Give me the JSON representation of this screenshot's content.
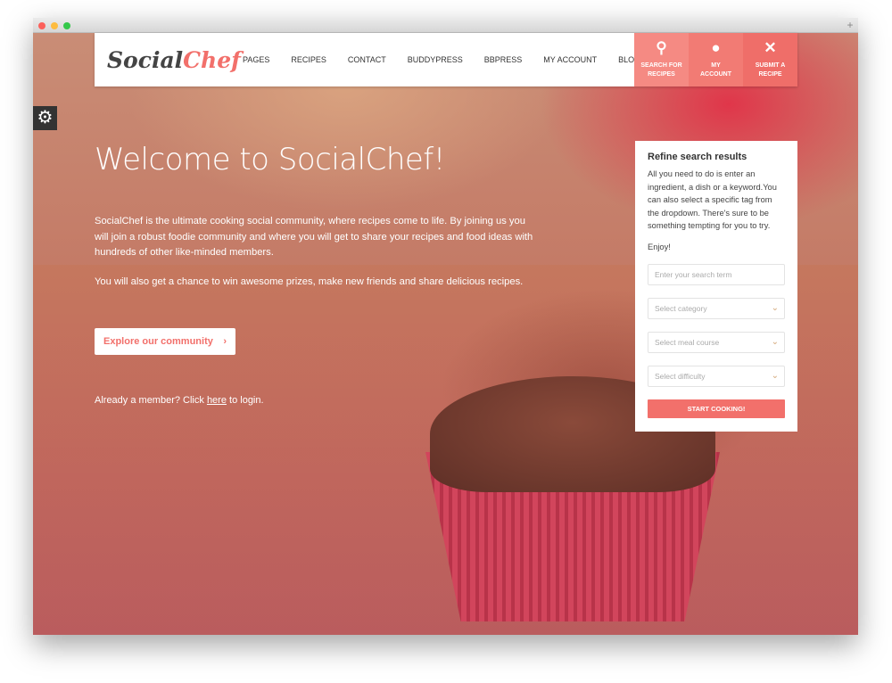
{
  "window": {
    "dots": [
      "#fc605b",
      "#fdbc40",
      "#34c84a"
    ]
  },
  "logo": {
    "part1": "Social",
    "part2": "Chef"
  },
  "menu": [
    "PAGES",
    "RECIPES",
    "CONTACT",
    "BUDDYPRESS",
    "BBPRESS",
    "MY ACCOUNT",
    "BLOG"
  ],
  "nav_buttons": [
    {
      "icon": "search-icon",
      "glyph": "⚲",
      "line1": "SEARCH FOR",
      "line2": "RECIPES",
      "color": "#f58a83"
    },
    {
      "icon": "user-icon",
      "glyph": "👤",
      "line1": "MY",
      "line2": "ACCOUNT",
      "color": "#f27b74"
    },
    {
      "icon": "fork-knife-icon",
      "glyph": "✕",
      "line1": "SUBMIT A",
      "line2": "RECIPE",
      "color": "#ef6e69"
    }
  ],
  "hero": {
    "title": "Welcome to SocialChef!",
    "p1": "SocialChef is the ultimate cooking social community, where recipes come to life. By joining us you will join a robust foodie community and where you will get to share your recipes and food ideas with hundreds of other like-minded members.",
    "p2": "You will also get a chance to win awesome prizes, make new friends and share delicious recipes.",
    "explore": "Explore our community",
    "member_pre": "Already a member? Click ",
    "member_link": "here",
    "member_post": " to login."
  },
  "search_panel": {
    "title": "Refine search results",
    "desc": "All you need to do is enter an ingredient, a dish or a keyword.You can also select a specific tag from the dropdown. There's sure to be something tempting for you to try.",
    "enjoy": "Enjoy!",
    "search_placeholder": "Enter your search term",
    "category": "Select category",
    "meal_course": "Select meal course",
    "difficulty": "Select difficulty",
    "submit": "START COOKING!"
  }
}
